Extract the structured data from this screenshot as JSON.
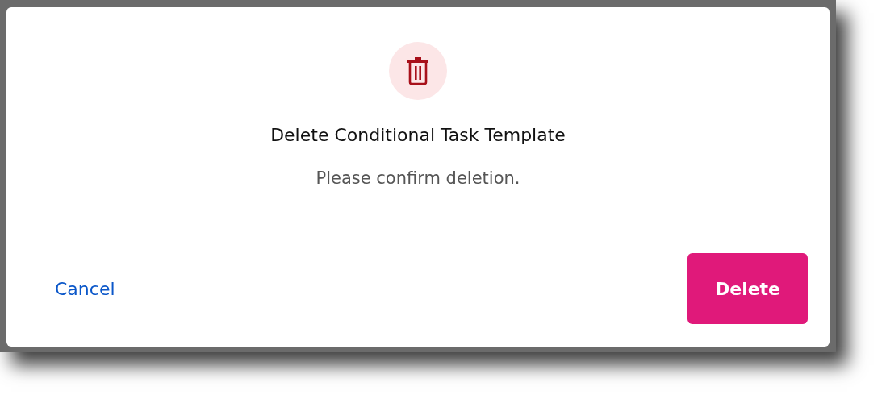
{
  "dialog": {
    "title": "Delete Conditional Task Template",
    "message": "Please confirm deletion.",
    "buttons": [
      {
        "kind": "link",
        "label": "Cancel"
      },
      {
        "kind": "primary",
        "label": "Delete"
      }
    ]
  }
}
